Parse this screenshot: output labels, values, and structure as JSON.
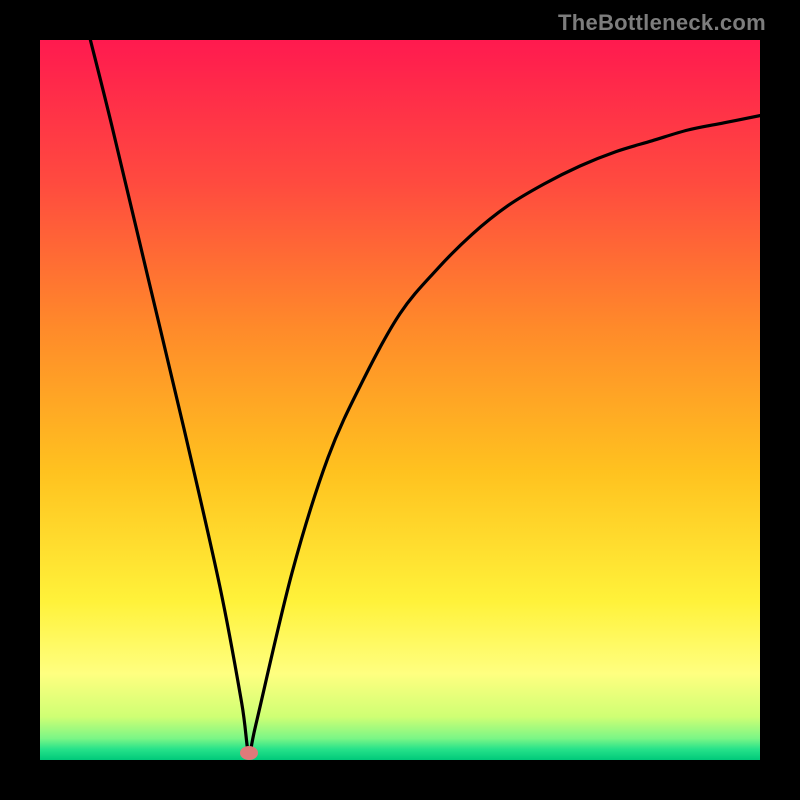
{
  "watermark": "TheBottleneck.com",
  "chart_data": {
    "type": "line",
    "title": "",
    "xlabel": "",
    "ylabel": "",
    "xlim": [
      0,
      100
    ],
    "ylim": [
      0,
      100
    ],
    "grid": false,
    "legend": false,
    "series": [
      {
        "name": "curve",
        "x": [
          7,
          10,
          15,
          20,
          25,
          28,
          29,
          30,
          35,
          40,
          45,
          50,
          55,
          60,
          65,
          70,
          75,
          80,
          85,
          90,
          95,
          100
        ],
        "y": [
          100,
          88,
          67,
          46,
          24,
          8,
          1,
          5,
          26,
          42,
          53,
          62,
          68,
          73,
          77,
          80,
          82.5,
          84.5,
          86,
          87.5,
          88.5,
          89.5
        ]
      }
    ],
    "marker": {
      "x": 29,
      "y": 1
    },
    "background": {
      "type": "vertical-gradient",
      "stops": [
        {
          "pos": 0.0,
          "color": "#ff1a4f"
        },
        {
          "pos": 0.2,
          "color": "#ff4b3f"
        },
        {
          "pos": 0.4,
          "color": "#ff8a2a"
        },
        {
          "pos": 0.6,
          "color": "#ffc21f"
        },
        {
          "pos": 0.78,
          "color": "#fff23a"
        },
        {
          "pos": 0.88,
          "color": "#ffff80"
        },
        {
          "pos": 0.94,
          "color": "#cfff74"
        },
        {
          "pos": 0.97,
          "color": "#7bf686"
        },
        {
          "pos": 0.985,
          "color": "#26e28a"
        },
        {
          "pos": 1.0,
          "color": "#00c97a"
        }
      ]
    }
  }
}
